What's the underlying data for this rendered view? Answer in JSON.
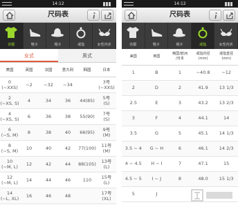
{
  "status": {
    "time": "14:12"
  },
  "app": {
    "title": "尺码表"
  },
  "categories": [
    {
      "label": "衣服",
      "icon": "tshirt-icon"
    },
    {
      "label": "鞋子",
      "icon": "shoe-icon"
    },
    {
      "label": "帽子",
      "icon": "hat-icon"
    },
    {
      "label": "戒指",
      "icon": "ring-icon"
    },
    {
      "label": "女性内衣",
      "icon": "bra-icon"
    }
  ],
  "gender_tabs": {
    "female": "女式",
    "male": "男式"
  },
  "clothing_table": {
    "headers": [
      "美国",
      "英国",
      "法国",
      "意大利",
      "韩国",
      "日本"
    ],
    "rows": [
      [
        "0\n(~XXS)",
        "~2",
        "~32",
        "~34",
        "",
        "3号\n(~XXS)"
      ],
      [
        "2\n(~XS, S)",
        "4",
        "34",
        "36",
        "44(85)",
        "5号\n(S)"
      ],
      [
        "4\n(~XS, S)",
        "6",
        "36",
        "38",
        "55(90)",
        "7号\n(S)"
      ],
      [
        "6\n(~S, M)",
        "8",
        "38",
        "40",
        "66(95)",
        "9号\n(M)"
      ],
      [
        "8\n(~S, M)",
        "10",
        "40",
        "42",
        "77(100)",
        "11号\n(M)"
      ],
      [
        "10\n(~M, L)",
        "12",
        "42",
        "44",
        "88(105)",
        "13号\n(L)"
      ],
      [
        "12\n(~M, L)",
        "14",
        "44",
        "46",
        "110",
        "15号\n(L)"
      ],
      [
        "14\n(~L, XL)",
        "16",
        "46",
        "48",
        "",
        "17号\n(XL)"
      ]
    ]
  },
  "ring_table": {
    "headers": [
      "美国",
      "英国",
      "韩国/欧洲\n/日本",
      "戒指内径\n(mm)",
      "戒指直径\n(mm)"
    ],
    "rows": [
      [
        "1",
        "B",
        "1",
        "~40.8",
        "~12"
      ],
      [
        "2",
        "D",
        "2",
        "41.9",
        "13 1/3"
      ],
      [
        "2.5",
        "E",
        "3",
        "43.2",
        "13 2/3"
      ],
      [
        "3",
        "F",
        "4",
        "44.1",
        "14"
      ],
      [
        "3.5",
        "G",
        "5",
        "45.1",
        "14 1/3"
      ],
      [
        "3.5 ~ 4",
        "G ~ H",
        "6",
        "46.1",
        "14 2/3"
      ],
      [
        "4 ~ 4.5",
        "H ~ I",
        "7",
        "47.1",
        "15"
      ],
      [
        "4.5 ~ 5",
        "I ~ J",
        "8",
        "48.0",
        "15 1/3"
      ],
      [
        "5",
        "J",
        "",
        "",
        ""
      ]
    ]
  },
  "colors": {
    "active_green": "#9bd62c",
    "active_red": "#e05a3a",
    "bar_dark": "#3c3c3c"
  }
}
